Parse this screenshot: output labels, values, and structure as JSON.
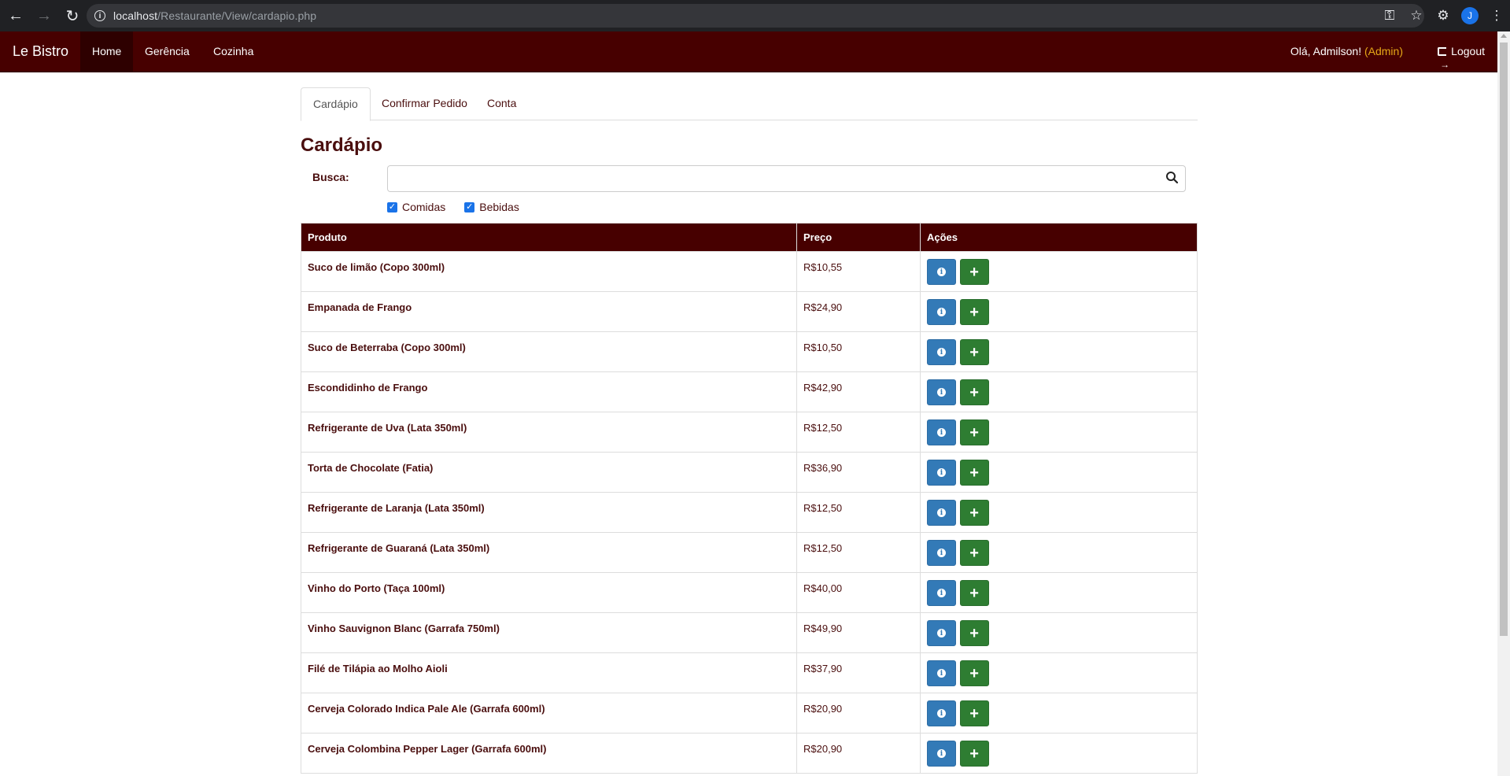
{
  "browser": {
    "url_host": "localhost",
    "url_path": "/Restaurante/View/cardapio.php",
    "avatar_letter": "J"
  },
  "navbar": {
    "brand": "Le Bistro",
    "items": [
      {
        "label": "Home",
        "active": true
      },
      {
        "label": "Gerência",
        "active": false
      },
      {
        "label": "Cozinha",
        "active": false
      }
    ],
    "greeting": "Olá, Admilson!",
    "role": "(Admin)",
    "logout": "Logout"
  },
  "tabs": [
    {
      "label": "Cardápio",
      "active": true
    },
    {
      "label": "Confirmar Pedido",
      "active": false
    },
    {
      "label": "Conta",
      "active": false
    }
  ],
  "page_title": "Cardápio",
  "search": {
    "label": "Busca:",
    "value": "",
    "placeholder": ""
  },
  "filters": [
    {
      "label": "Comidas",
      "checked": true
    },
    {
      "label": "Bebidas",
      "checked": true
    }
  ],
  "table": {
    "headers": [
      "Produto",
      "Preço",
      "Ações"
    ],
    "rows": [
      {
        "product": "Suco de limão (Copo 300ml)",
        "price": "R$10,55"
      },
      {
        "product": "Empanada de Frango",
        "price": "R$24,90"
      },
      {
        "product": "Suco de Beterraba (Copo 300ml)",
        "price": "R$10,50"
      },
      {
        "product": "Escondidinho de Frango",
        "price": "R$42,90"
      },
      {
        "product": "Refrigerante de Uva (Lata 350ml)",
        "price": "R$12,50"
      },
      {
        "product": "Torta de Chocolate (Fatia)",
        "price": "R$36,90"
      },
      {
        "product": "Refrigerante de Laranja (Lata 350ml)",
        "price": "R$12,50"
      },
      {
        "product": "Refrigerante de Guaraná (Lata 350ml)",
        "price": "R$12,50"
      },
      {
        "product": "Vinho do Porto (Taça 100ml)",
        "price": "R$40,00"
      },
      {
        "product": "Vinho Sauvignon Blanc (Garrafa 750ml)",
        "price": "R$49,90"
      },
      {
        "product": "Filé de Tilápia ao Molho Aioli",
        "price": "R$37,90"
      },
      {
        "product": "Cerveja Colorado Indica Pale Ale (Garrafa 600ml)",
        "price": "R$20,90"
      },
      {
        "product": "Cerveja Colombina Pepper Lager (Garrafa 600ml)",
        "price": "R$20,90"
      }
    ]
  },
  "colors": {
    "brand": "#470000",
    "role": "#e6a817",
    "info_button": "#337ab7",
    "add_button": "#2e7d32"
  }
}
